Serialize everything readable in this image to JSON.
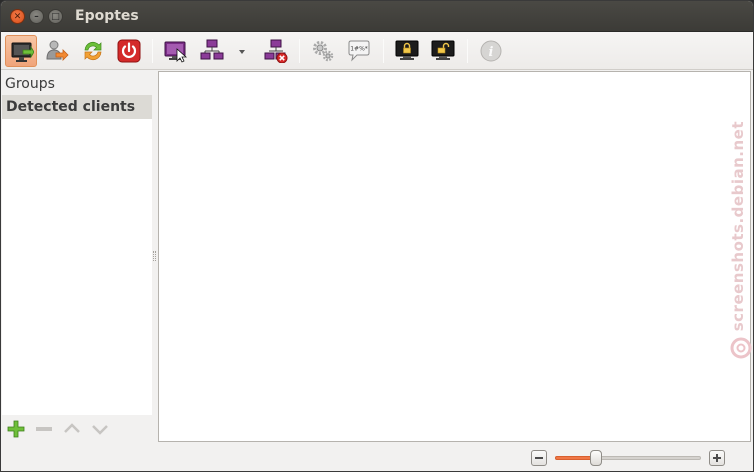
{
  "window": {
    "title": "Epoptes",
    "controls": [
      "close-icon",
      "minimize-icon",
      "maximize-icon"
    ]
  },
  "toolbar": {
    "buttons": [
      {
        "name": "broadcast-screen",
        "icon": "monitor-arrow-icon",
        "active": true
      },
      {
        "name": "login",
        "icon": "user-arrow-icon"
      },
      {
        "name": "reboot",
        "icon": "refresh-icon"
      },
      {
        "name": "shutdown",
        "icon": "power-icon"
      },
      {
        "name": "observe",
        "icon": "monitor-cursor-icon"
      },
      {
        "name": "broadcast",
        "icon": "network-monitors-icon"
      },
      {
        "name": "broadcast-dropdown",
        "icon": "dropdown-arrow-icon"
      },
      {
        "name": "stop-broadcast",
        "icon": "network-stop-icon"
      },
      {
        "name": "execute",
        "icon": "gears-icon"
      },
      {
        "name": "send-message",
        "icon": "speech-bubble-icon"
      },
      {
        "name": "lock-screen",
        "icon": "lock-monitor-icon"
      },
      {
        "name": "unlock-screen",
        "icon": "unlock-monitor-icon"
      },
      {
        "name": "info",
        "icon": "info-icon"
      }
    ]
  },
  "sidebar": {
    "header": "Groups",
    "items": [
      {
        "label": "Detected clients",
        "selected": true
      }
    ],
    "actions": [
      "add-icon",
      "remove-icon",
      "move-up-icon",
      "move-down-icon"
    ]
  },
  "watermark": {
    "text": "screenshots.debian.net"
  },
  "statusbar": {
    "zoom_level": 0.28
  },
  "colors": {
    "accent": "#f07746",
    "titlebar": "#3c3b37",
    "close_button": "#df5a23"
  }
}
